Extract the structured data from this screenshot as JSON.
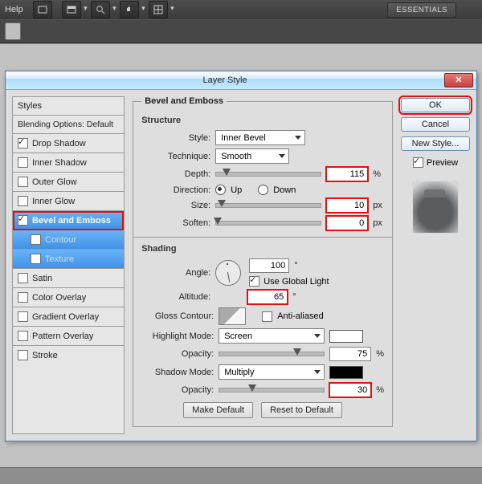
{
  "app": {
    "menu_help": "Help",
    "workspace_label": "ESSENTIALS"
  },
  "dialog": {
    "title": "Layer Style",
    "styles_header": "Styles",
    "blending_label": "Blending Options: Default",
    "items": [
      {
        "label": "Drop Shadow",
        "checked": true
      },
      {
        "label": "Inner Shadow",
        "checked": false
      },
      {
        "label": "Outer Glow",
        "checked": false
      },
      {
        "label": "Inner Glow",
        "checked": false
      }
    ],
    "bevel_label": "Bevel and Emboss",
    "bevel_checked": true,
    "bevel_subs": [
      {
        "label": "Contour",
        "checked": false
      },
      {
        "label": "Texture",
        "checked": false
      }
    ],
    "items2": [
      {
        "label": "Satin",
        "checked": false
      },
      {
        "label": "Color Overlay",
        "checked": false
      },
      {
        "label": "Gradient Overlay",
        "checked": false
      },
      {
        "label": "Pattern Overlay",
        "checked": false
      },
      {
        "label": "Stroke",
        "checked": false
      }
    ],
    "section_title": "Bevel and Emboss",
    "structure": {
      "heading": "Structure",
      "style_label": "Style:",
      "style_value": "Inner Bevel",
      "technique_label": "Technique:",
      "technique_value": "Smooth",
      "depth_label": "Depth:",
      "depth_value": "115",
      "depth_unit": "%",
      "direction_label": "Direction:",
      "direction_up": "Up",
      "direction_down": "Down",
      "size_label": "Size:",
      "size_value": "10",
      "size_unit": "px",
      "soften_label": "Soften:",
      "soften_value": "0",
      "soften_unit": "px"
    },
    "shading": {
      "heading": "Shading",
      "angle_label": "Angle:",
      "angle_value": "100",
      "angle_unit": "°",
      "use_global_label": "Use Global Light",
      "use_global_checked": true,
      "altitude_label": "Altitude:",
      "altitude_value": "65",
      "altitude_unit": "°",
      "gloss_label": "Gloss Contour:",
      "antialias_label": "Anti-aliased",
      "antialias_checked": false,
      "highlight_label": "Highlight Mode:",
      "highlight_value": "Screen",
      "highlight_color": "#ffffff",
      "opacity1_label": "Opacity:",
      "opacity1_value": "75",
      "opacity1_unit": "%",
      "shadow_label": "Shadow Mode:",
      "shadow_value": "Multiply",
      "shadow_color": "#000000",
      "opacity2_label": "Opacity:",
      "opacity2_value": "30",
      "opacity2_unit": "%"
    },
    "make_default": "Make Default",
    "reset_default": "Reset to Default",
    "ok": "OK",
    "cancel": "Cancel",
    "new_style": "New Style...",
    "preview_label": "Preview",
    "preview_checked": true
  }
}
